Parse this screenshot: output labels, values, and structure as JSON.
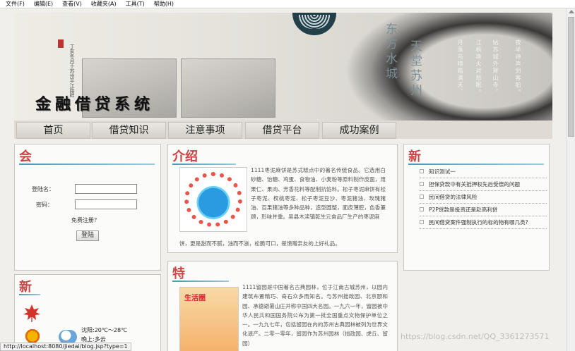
{
  "menu": [
    "文件(F)",
    "编辑(E)",
    "查看(V)",
    "收藏夹(A)",
    "工具(T)",
    "帮助(H)"
  ],
  "banner": {
    "site_title": "金融借贷系统",
    "col_left": "东方水城",
    "col_right": "天堂苏州",
    "poem": [
      "夜半钟声到客船。",
      "姑苏城外寒山寺，",
      "江枫渔火对愁眠。",
      "月落乌啼霜满天，"
    ],
    "seal_text": "丁亥冬月于苏州平江路畔"
  },
  "nav": [
    "首页",
    "借贷知识",
    "注意事项",
    "借贷平台",
    "成功案例"
  ],
  "login": {
    "heading": "会",
    "username_label": "登陆名：",
    "password_label": "密码：",
    "username_value": "",
    "password_value": "",
    "register_link": "免费注册？",
    "login_button": "登陆"
  },
  "weather": {
    "heading": "新",
    "line1": "沈阳:20℃～28℃",
    "line2": "晚上:多云"
  },
  "intro": {
    "heading": "介绍",
    "text_main": "1111枣泥麻饼是苏式糕点中的著名传统食品。它选用白砂糖、饴糖、鸡蛋、食物油、小麦粉等原料制作皮面，用果仁、果肉、芳香花料等配制抗馅料。松子枣泥麻饼有松子枣泥、杈桃枣泥、松子枣泥豆沙、枣泥猪油、玫瑰猪油、百果猪油等多种品种，造型圆整，面皮薄腔，色香兼顾，形味并重。吴县木渎镇乾生元食品厂生产的枣泥麻",
    "text_cont": "饼，更是甜而不腻，油而不滋，松脆可口，是馈赠亲友的上好礼品。"
  },
  "special": {
    "heading": "特",
    "image_badge": "生活圈",
    "text": "1111留园是中国著名古典园林，位于江南古城苏州，以园内建筑布置精巧、奇石众多而知名。与苏州拙政园、北京颐和园、承德避暑山庄并称中国四大名园。一九六一年，留园被中华人民共和国国务院公布为第一批全国重点文物保护单位之一。一九九七年，包括留园在内的苏州古典园林被列为世界文化遗产。二零一零年，留园作为苏州园林（拙政园、虎丘、留园）"
  },
  "news": {
    "heading": "新",
    "items": [
      "知识测试一",
      "担保贷款中有关抵押权先后受偿的问题",
      "民间借贷的法律风险",
      "P2P贷款是投资还是赴高利贷",
      "民间借贷案件强制执行的标的物有哪几类?"
    ]
  },
  "watermark": "https://blog.csdn.net/QQ_3361273571",
  "status_url": "http://localhost:8080/jiedai/blog.jsp?type=1"
}
